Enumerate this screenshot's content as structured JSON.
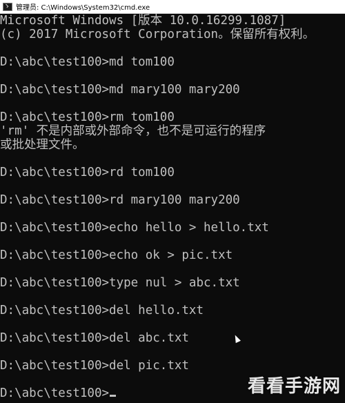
{
  "window": {
    "title": "管理员: C:\\Windows\\System32\\cmd.exe",
    "icon": "cmd-icon"
  },
  "console": {
    "lines": [
      "Microsoft Windows [版本 10.0.16299.1087]",
      "(c) 2017 Microsoft Corporation。保留所有权利。",
      "",
      "D:\\abc\\test100>md tom100",
      "",
      "D:\\abc\\test100>md mary100 mary200",
      "",
      "D:\\abc\\test100>rm tom100",
      "'rm' 不是内部或外部命令，也不是可运行的程序",
      "或批处理文件。",
      "",
      "D:\\abc\\test100>rd tom100",
      "",
      "D:\\abc\\test100>rd mary100 mary200",
      "",
      "D:\\abc\\test100>echo hello > hello.txt",
      "",
      "D:\\abc\\test100>echo ok > pic.txt",
      "",
      "D:\\abc\\test100>type nul > abc.txt",
      "",
      "D:\\abc\\test100>del hello.txt",
      "",
      "D:\\abc\\test100>del abc.txt",
      "",
      "D:\\abc\\test100>del pic.txt",
      "",
      "D:\\abc\\test100>"
    ]
  },
  "watermark": {
    "text": "看看手游网"
  },
  "colors": {
    "console_bg": "#0c0c0c",
    "console_text": "#c0c0c0",
    "titlebar_bg": "#ffffff"
  }
}
